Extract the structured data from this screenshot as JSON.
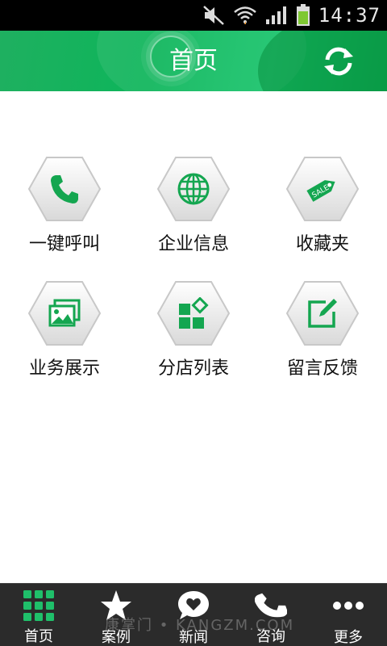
{
  "status_bar": {
    "time": "14:37"
  },
  "header": {
    "title": "首页"
  },
  "grid": [
    {
      "label": "一键呼叫",
      "icon": "phone-icon"
    },
    {
      "label": "企业信息",
      "icon": "globe-icon"
    },
    {
      "label": "收藏夹",
      "icon": "sale-tag-icon"
    },
    {
      "label": "业务展示",
      "icon": "image-gallery-icon"
    },
    {
      "label": "分店列表",
      "icon": "blocks-icon"
    },
    {
      "label": "留言反馈",
      "icon": "edit-icon"
    }
  ],
  "bottom_nav": [
    {
      "label": "首页",
      "icon": "grid-icon"
    },
    {
      "label": "案例",
      "icon": "star-icon"
    },
    {
      "label": "新闻",
      "icon": "heart-chat-icon"
    },
    {
      "label": "咨询",
      "icon": "phone-icon"
    },
    {
      "label": "更多",
      "icon": "more-dots-icon"
    }
  ],
  "watermark": "康掌门 • KANGZM.COM",
  "colors": {
    "accent": "#12b35c",
    "nav_bg": "#2b2b2b",
    "nav_home_icon": "#1fbf6a"
  }
}
